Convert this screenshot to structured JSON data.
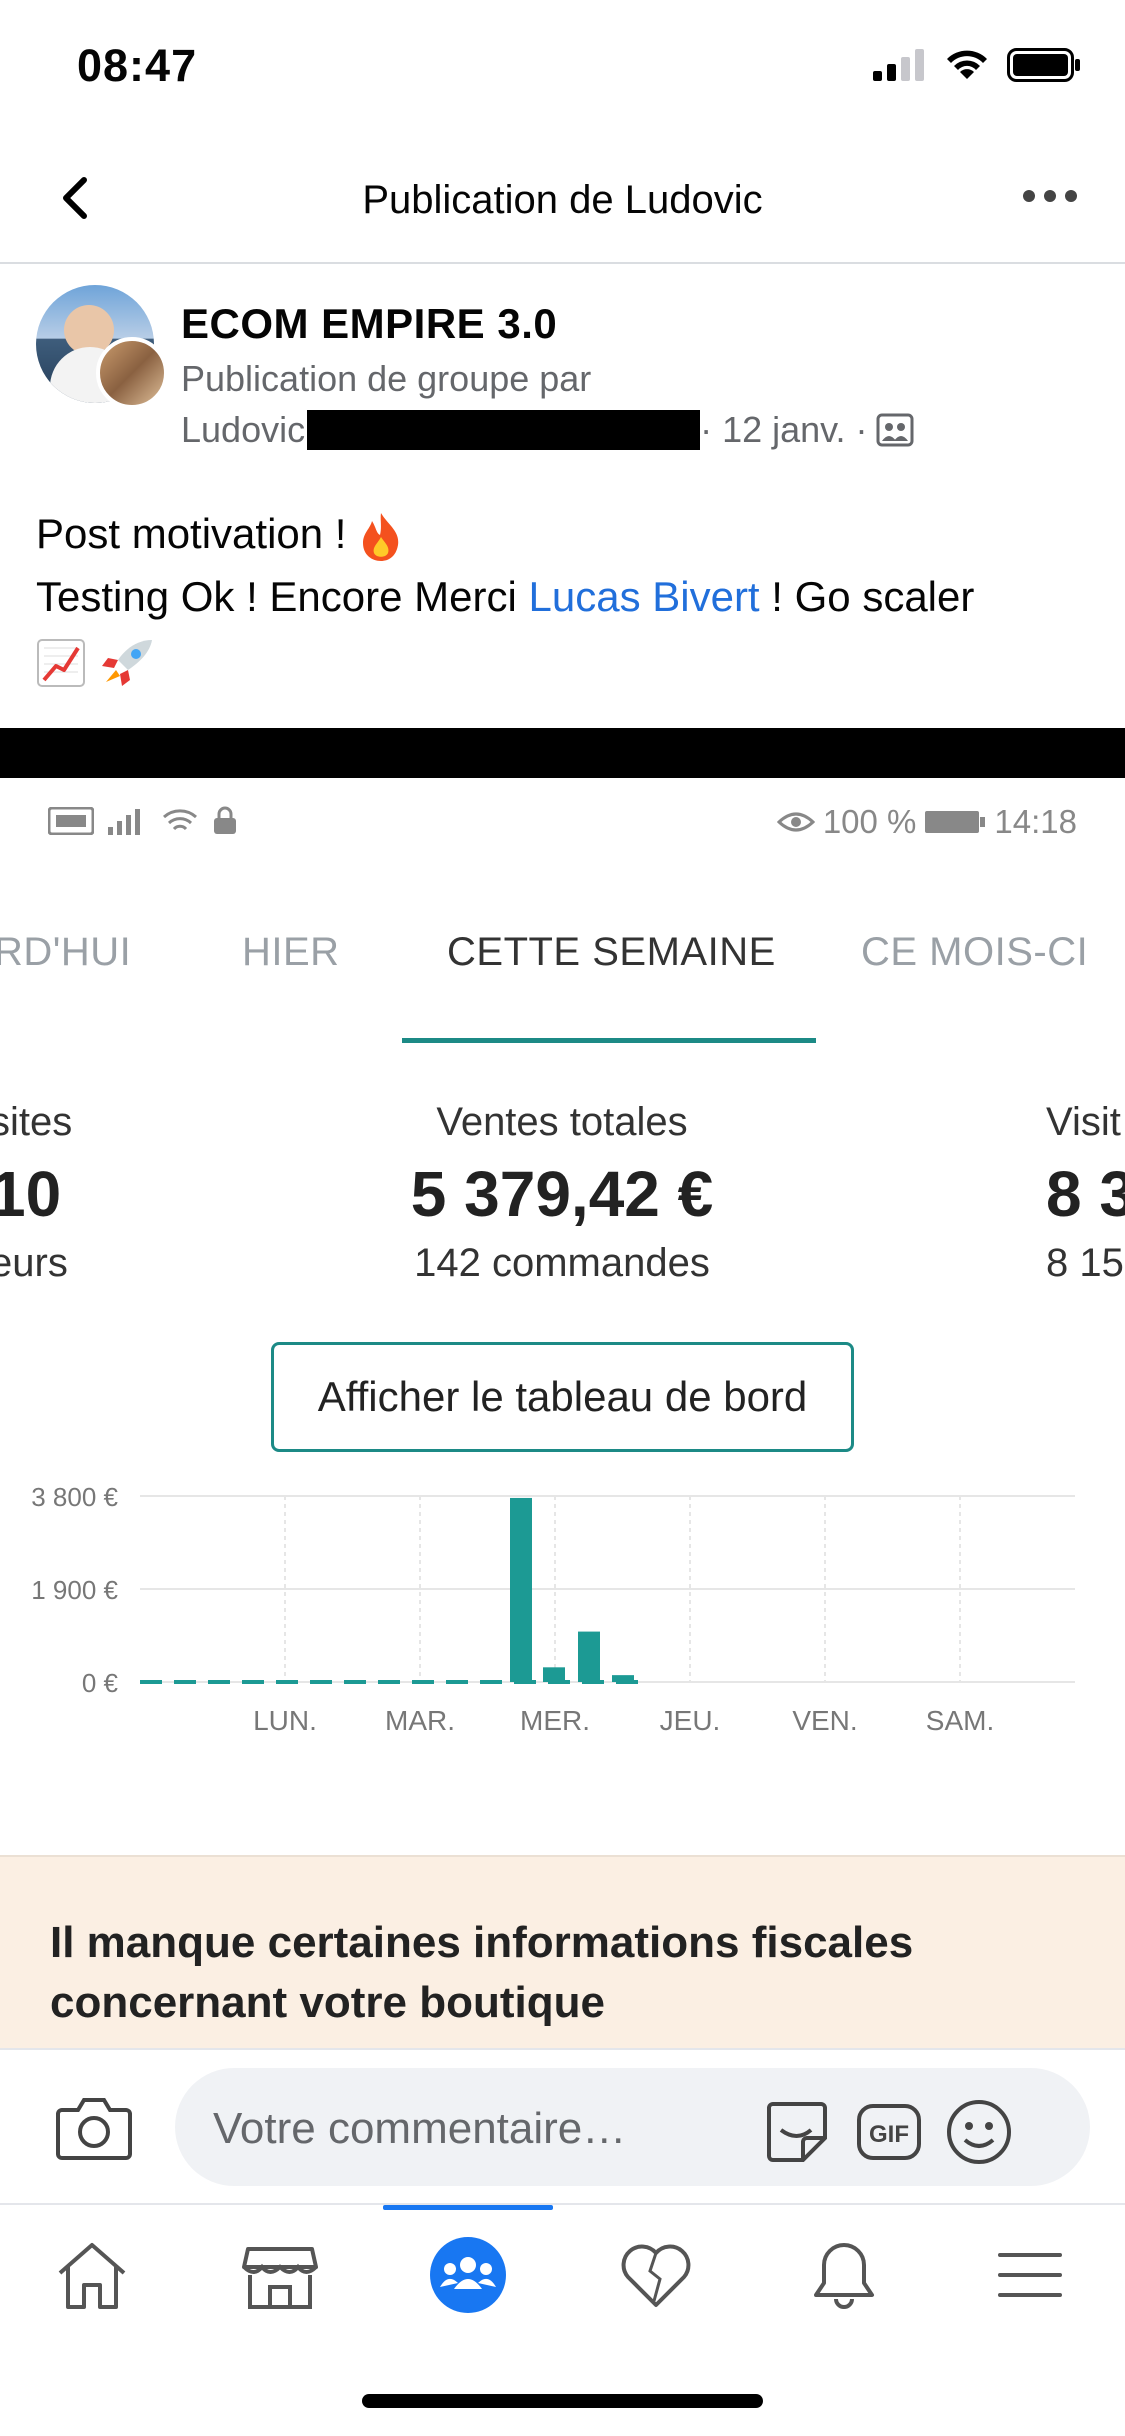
{
  "status_bar": {
    "time": "08:47"
  },
  "header": {
    "title": "Publication de Ludovic"
  },
  "post": {
    "group_name": "ECOM EMPIRE 3.0",
    "subtitle": "Publication de groupe par",
    "author": "Ludovic",
    "date": "· 12 janv. ·",
    "text_line1": "Post motivation ! ",
    "text_line2_before": "Testing Ok ! Encore Merci ",
    "mention": "Lucas Bivert",
    "text_line2_after": " ! Go scaler"
  },
  "screenshot": {
    "status_right": "100 %",
    "status_time": "14:18",
    "tabs": [
      "RD'HUI",
      "HIER",
      "CETTE SEMAINE",
      "CE MOIS-CI"
    ],
    "active_tab": "CETTE SEMAINE",
    "stats": {
      "left": {
        "label": "sites",
        "value": "10",
        "sub": "eurs"
      },
      "center": {
        "label": "Ventes totales",
        "value": "5 379,42 €",
        "sub": "142 commandes"
      },
      "right": {
        "label": "Visit",
        "value": "8 3",
        "sub": "8 15"
      }
    },
    "dashboard_button": "Afficher le tableau de bord",
    "warning": "Il manque certaines informations fiscales concernant votre boutique"
  },
  "chart_data": {
    "type": "bar",
    "y_ticks": [
      "3 800 €",
      "1 900 €",
      "0 €"
    ],
    "ylim": [
      0,
      3800
    ],
    "day_labels": [
      "LUN.",
      "MAR.",
      "MER.",
      "JEU.",
      "VEN.",
      "SAM."
    ],
    "note": "Bars represent sales within the Wednesday (MER.) period",
    "values": [
      3760,
      300,
      1030,
      140
    ],
    "bar_color": "#1c9a94"
  },
  "comment_bar": {
    "placeholder": "Votre commentaire…",
    "gif_label": "GIF"
  },
  "colors": {
    "accent": "#1877f2",
    "mention": "#216fdb",
    "shopify_teal": "#1c8a86"
  }
}
